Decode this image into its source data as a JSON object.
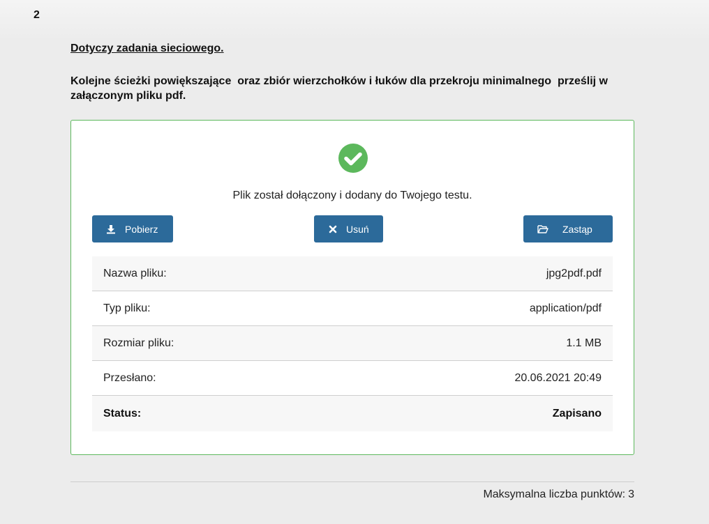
{
  "question": {
    "number": "2",
    "heading": "Dotyczy zadania sieciowego.",
    "text": "Kolejne ścieżki powiększające  oraz zbiór wierzchołków i łuków dla przekroju minimalnego  prześlij w załączonym pliku pdf."
  },
  "upload": {
    "status_icon": "check-circle-icon",
    "success_color": "#5cb85c",
    "button_color": "#2c6a9a",
    "message": "Plik został dołączony i dodany do Twojego testu.",
    "buttons": {
      "download": {
        "label": "Pobierz",
        "icon": "download-icon"
      },
      "delete": {
        "label": "Usuń",
        "icon": "close-icon"
      },
      "replace": {
        "label": "Zastąp",
        "icon": "folder-open-icon"
      }
    },
    "details": [
      {
        "label": "Nazwa pliku:",
        "value": "jpg2pdf.pdf"
      },
      {
        "label": "Typ pliku:",
        "value": "application/pdf"
      },
      {
        "label": "Rozmiar pliku:",
        "value": "1.1 MB"
      },
      {
        "label": "Przesłano:",
        "value": "20.06.2021 20:49"
      },
      {
        "label": "Status:",
        "value": "Zapisano"
      }
    ]
  },
  "footer": {
    "max_points_label": "Maksymalna liczba punktów:",
    "max_points_value": "3"
  }
}
